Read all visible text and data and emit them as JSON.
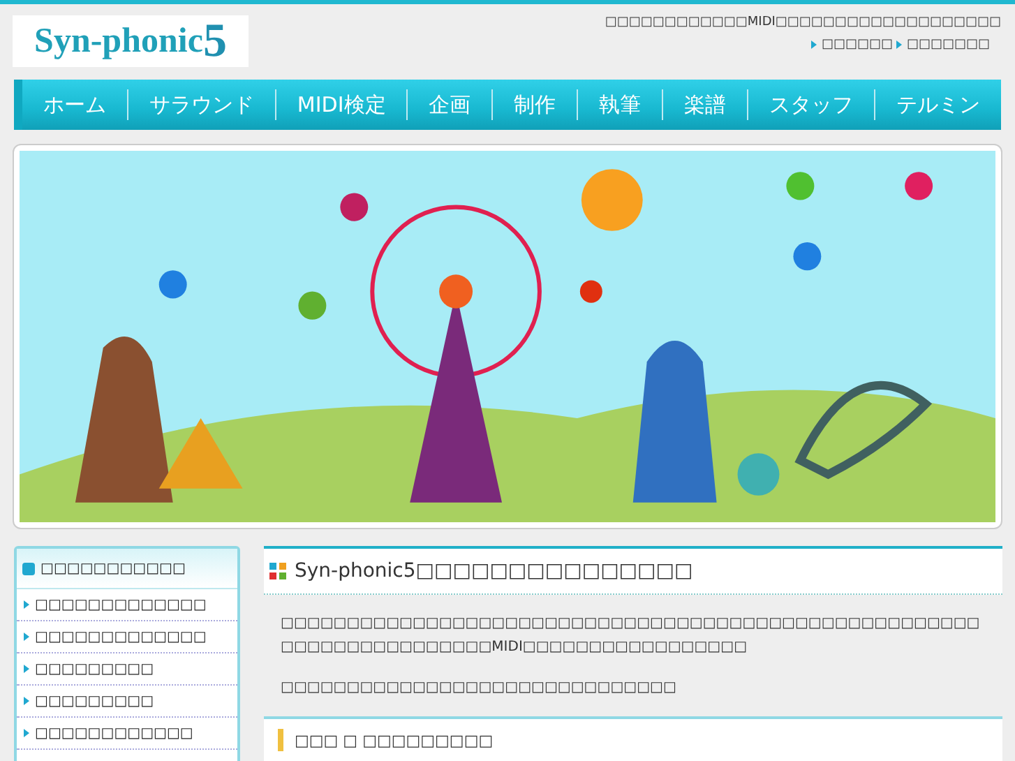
{
  "logo": {
    "name": "Syn-phonic",
    "number": "5"
  },
  "header": {
    "tagline": "□□□□□□□□□□□□MIDI□□□□□□□□□□□□□□□□□□□",
    "links": [
      "□□□□□□",
      "□□□□□□□"
    ]
  },
  "nav": [
    {
      "label": "ホーム"
    },
    {
      "label": "サラウンド"
    },
    {
      "label": "MIDI検定"
    },
    {
      "label": "企画"
    },
    {
      "label": "制作"
    },
    {
      "label": "執筆"
    },
    {
      "label": "楽譜"
    },
    {
      "label": "スタッフ"
    },
    {
      "label": "テルミン"
    }
  ],
  "sidebar": {
    "title": "□□□□□□□□□□□",
    "items": [
      "□□□□□□□□□□□□□",
      "□□□□□□□□□□□□□",
      "□□□□□□□□□",
      "□□□□□□□□□",
      "□□□□□□□□□□□□"
    ]
  },
  "main": {
    "heading": "Syn-phonic5□□□□□□□□□□□□□□□",
    "paragraphs": [
      "□□□□□□□□□□□□□□□□□□□□□□□□□□□□□□□□□□□□□□□□□□□□□□□□□□□□□□□□□□□□□□□□□□□□□MIDI□□□□□□□□□□□□□□□□□",
      "□□□□□□□□□□□□□□□□□□□□□□□□□□□□□□"
    ],
    "subheading": "□□□ □ □□□□□□□□□"
  }
}
